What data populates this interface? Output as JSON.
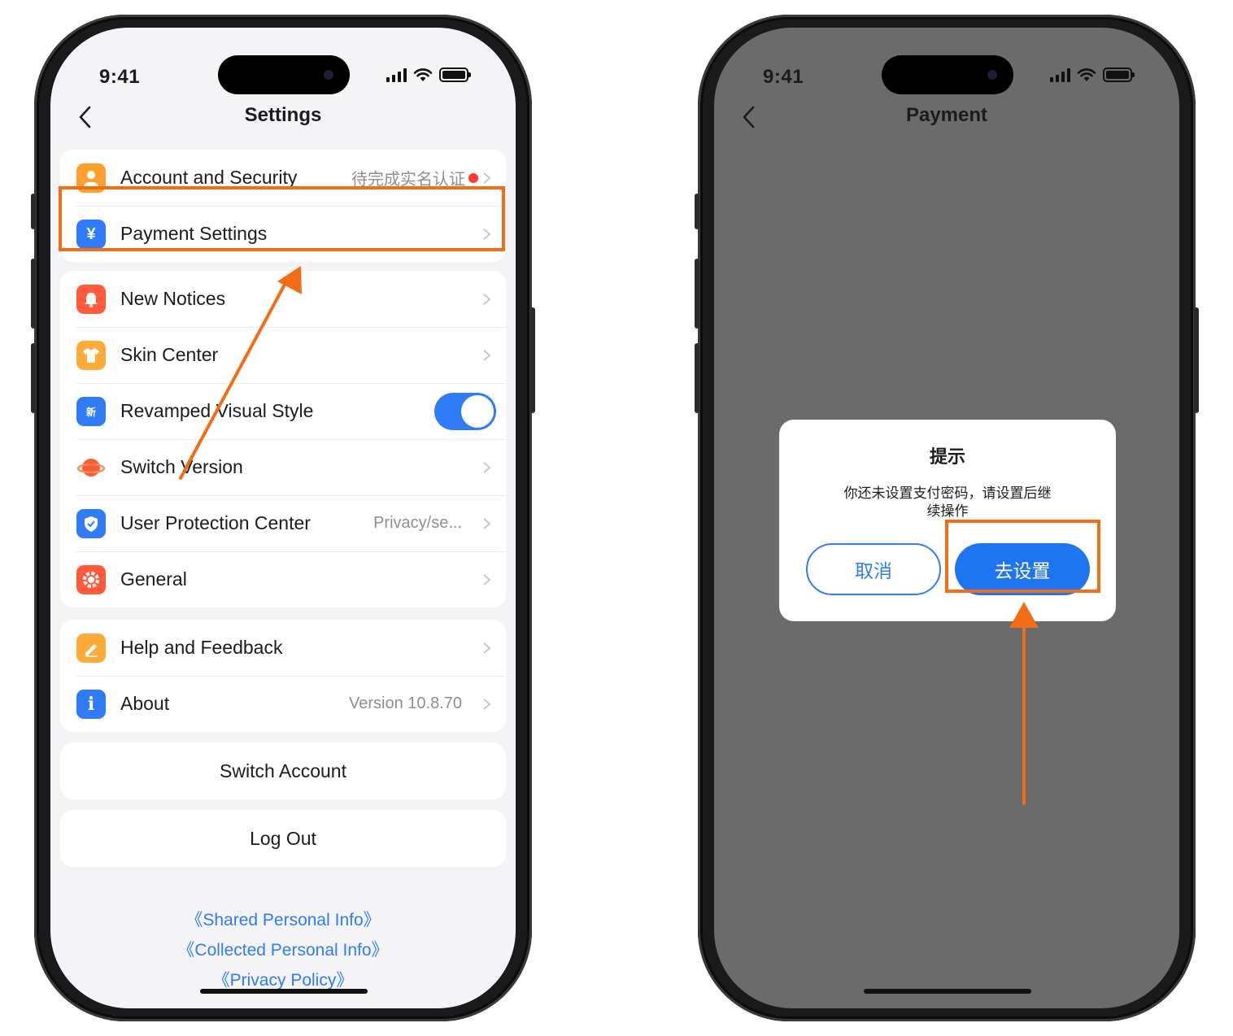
{
  "colors": {
    "accent": "#2f7cf6",
    "highlight": "#f26d15",
    "badge_red": "#ff3b30",
    "overlay": "#6b6b6b"
  },
  "status": {
    "time": "9:41"
  },
  "settings": {
    "title": "Settings",
    "rows": [
      {
        "label": "Account and Security",
        "value": "待完成实名认证",
        "icon": "person-icon",
        "color": "#ff9f2e"
      },
      {
        "label": "Payment Settings",
        "value": "",
        "icon": "yen-icon",
        "color": "#2f7cf6"
      },
      {
        "label": "New Notices",
        "value": "",
        "icon": "bell-icon",
        "color": "#ff5a3c"
      },
      {
        "label": "Skin Center",
        "value": "",
        "icon": "shirt-icon",
        "color": "#ffab3a"
      },
      {
        "label": "Revamped Visual Style",
        "value": "",
        "icon": "new-style-icon",
        "color": "#2f7cf6",
        "toggle_on": true
      },
      {
        "label": "Switch Version",
        "value": "",
        "icon": "planet-icon",
        "color": "#ff5a3c"
      },
      {
        "label": "User Protection Center",
        "value": "Privacy/se...",
        "icon": "shield-icon",
        "color": "#2f7cf6"
      },
      {
        "label": "General",
        "value": "",
        "icon": "gear-icon",
        "color": "#ff5a3c"
      },
      {
        "label": "Help and Feedback",
        "value": "",
        "icon": "pencil-icon",
        "color": "#ffab3a"
      },
      {
        "label": "About",
        "value": "Version 10.8.70",
        "icon": "info-icon",
        "color": "#2f7cf6"
      }
    ],
    "switch_account": "Switch Account",
    "log_out": "Log Out",
    "links": [
      "《Shared Personal Info》",
      "《Collected Personal Info》",
      "《Privacy Policy》"
    ]
  },
  "payment": {
    "title": "Payment",
    "dialog": {
      "title": "提示",
      "message_line1": "你还未设置支付密码，请设置后继",
      "message_line2": "续操作",
      "cancel": "取消",
      "confirm": "去设置"
    }
  }
}
